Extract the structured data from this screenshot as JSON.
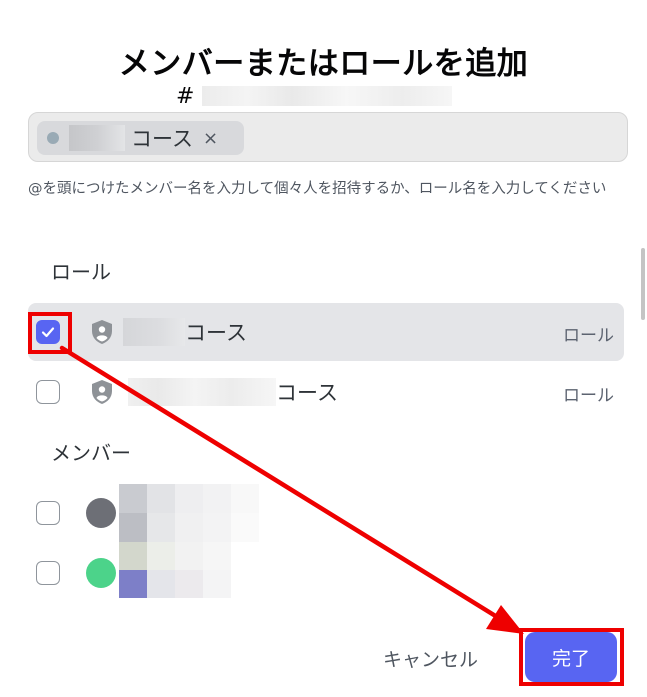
{
  "dialog": {
    "title": "メンバーまたはロールを追加",
    "channel_hash": "#"
  },
  "search": {
    "chip_label": "コース",
    "chip_remove": "×"
  },
  "hint": "@を頭につけたメンバー名を入力して個々人を招待するか、ロール名を入力してください",
  "roles_section": {
    "title": "ロール",
    "items": [
      {
        "name_suffix": "コース",
        "type": "ロール",
        "checked": true
      },
      {
        "name_suffix": "コース",
        "type": "ロール",
        "checked": false
      }
    ]
  },
  "members_section": {
    "title": "メンバー",
    "items": [
      {
        "checked": false
      },
      {
        "checked": false
      }
    ]
  },
  "footer": {
    "cancel_label": "キャンセル",
    "done_label": "完了"
  },
  "colors": {
    "accent": "#5865f2",
    "annotation": "#ee0000"
  }
}
